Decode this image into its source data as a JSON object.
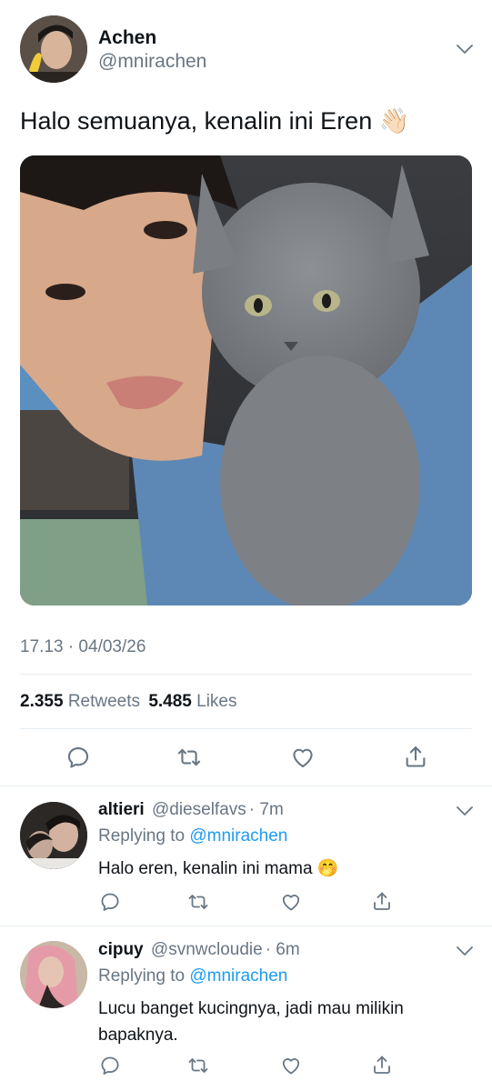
{
  "tweet": {
    "author_name": "Achen",
    "handle": "@mnirachen",
    "text": "Halo semuanya, kenalin ini Eren 👋🏻",
    "timestamp": "17.13 · 04/03/26",
    "retweets_count": "2.355",
    "retweets_label": "Retweets",
    "likes_count": "5.485",
    "likes_label": "Likes"
  },
  "replies": [
    {
      "name": "altieri",
      "handle": "@dieselfavs",
      "time": "· 7m",
      "replying_prefix": "Replying to",
      "replying_to": "@mnirachen",
      "text": "Halo eren, kenalin ini mama 🤭"
    },
    {
      "name": "cipuy",
      "handle": "@svnwcloudie",
      "time": "· 6m",
      "replying_prefix": "Replying to",
      "replying_to": "@mnirachen",
      "text": "Lucu banget kucingnya, jadi mau milikin bapaknya."
    }
  ],
  "colors": {
    "link": "#1d9bf0",
    "secondary_text": "#687684",
    "divider": "#e6ecf0"
  },
  "icons": [
    "chevron-down-icon",
    "reply-icon",
    "retweet-icon",
    "like-icon",
    "share-icon"
  ]
}
